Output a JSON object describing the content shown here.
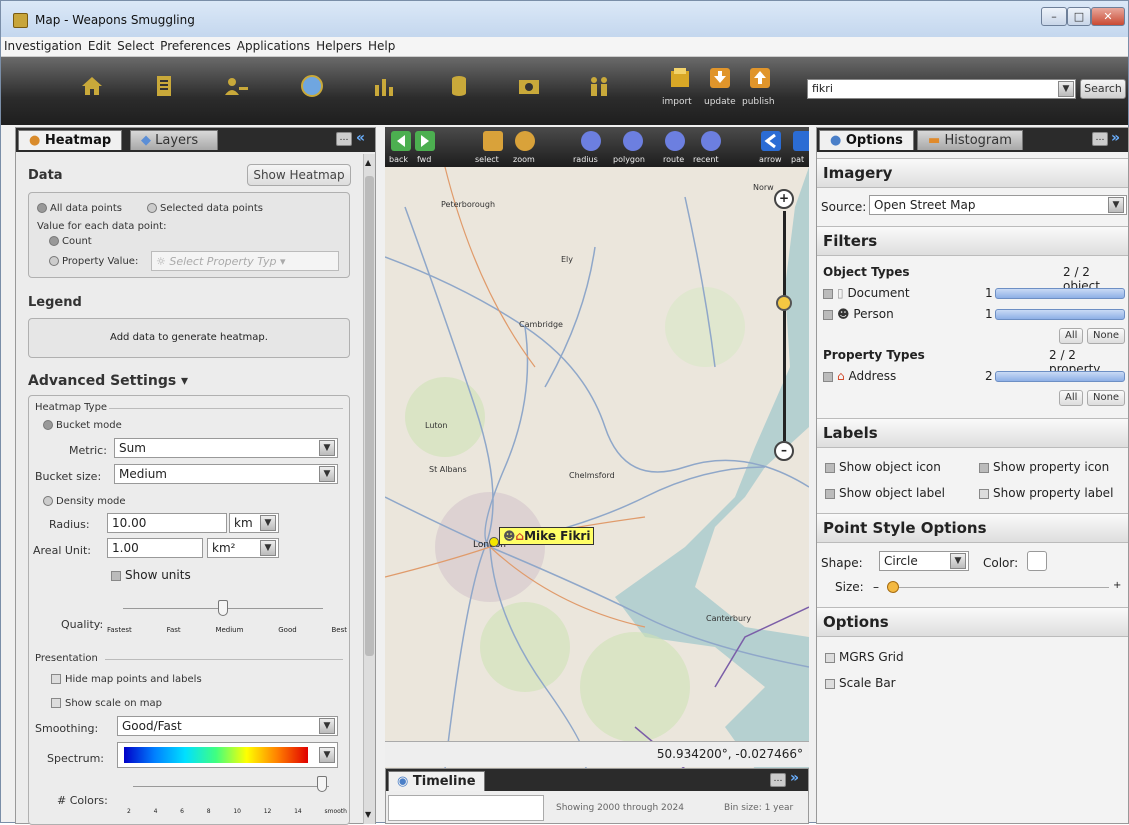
{
  "window": {
    "title": "Map - Weapons Smuggling"
  },
  "menu": [
    "Investigation",
    "Edit",
    "Select",
    "Preferences",
    "Applications",
    "Helpers",
    "Help"
  ],
  "toolbar": {
    "import": "import",
    "update": "update",
    "publish": "publish",
    "search_value": "fikri",
    "search_button": "Search",
    "accent": "#c9a93a"
  },
  "left": {
    "tabs": [
      "Heatmap",
      "Layers"
    ],
    "data_title": "Data",
    "show_heatmap": "Show Heatmap",
    "all_points": "All data points",
    "selected_points": "Selected data points",
    "value_for": "Value for each data point:",
    "count": "Count",
    "property_value": "Property Value:",
    "property_placeholder": "Select Property Typ",
    "legend_title": "Legend",
    "legend_text": "Add data to generate heatmap.",
    "advanced": "Advanced Settings ▾",
    "heatmap_type": "Heatmap Type",
    "bucket_mode": "Bucket mode",
    "metric_label": "Metric:",
    "metric_value": "Sum",
    "bucket_size_label": "Bucket size:",
    "bucket_size_value": "Medium",
    "density_mode": "Density mode",
    "radius_label": "Radius:",
    "radius_value": "10.00",
    "radius_unit": "km",
    "areal_label": "Areal Unit:",
    "areal_value": "1.00",
    "areal_unit": "km²",
    "show_units": "Show units",
    "quality_label": "Quality:",
    "quality_ticks": [
      "Fastest",
      "Fast",
      "Medium",
      "Good",
      "Best"
    ],
    "quality_level": 0.5,
    "presentation": "Presentation",
    "hide_points": "Hide map points and labels",
    "show_scale": "Show scale on map",
    "smoothing_label": "Smoothing:",
    "smoothing_value": "Good/Fast",
    "spectrum_label": "Spectrum:",
    "colors_label": "# Colors:",
    "colors_ticks": [
      "2",
      "4",
      "6",
      "8",
      "10",
      "12",
      "14",
      "smooth"
    ]
  },
  "map": {
    "tools": [
      "back",
      "fwd",
      "select",
      "zoom",
      "radius",
      "polygon",
      "route",
      "recent",
      "arrow",
      "pat"
    ],
    "places": [
      "Peterborough",
      "Ely",
      "Cambridge",
      "Luton",
      "St Albans",
      "Chelmsford",
      "London",
      "Canterbury",
      "Norw"
    ],
    "marker_label": "Mike Fikri",
    "coordinates": "50.934200°, -0.027466°",
    "zoom_level": 0.4
  },
  "timeline": {
    "title": "Timeline",
    "showing": "Showing 2000 through 2024",
    "bin": "Bin size: 1 year"
  },
  "right": {
    "tabs": [
      "Options",
      "Histogram"
    ],
    "imagery_title": "Imagery",
    "source_label": "Source:",
    "source_value": "Open Street Map",
    "filters_title": "Filters",
    "object_types": "Object Types",
    "object_count": "2 / 2 object",
    "document": "Document",
    "document_n": "1",
    "person": "Person",
    "person_n": "1",
    "all": "All",
    "none": "None",
    "property_types": "Property Types",
    "property_count": "2 / 2 property",
    "address": "Address",
    "address_n": "2",
    "labels_title": "Labels",
    "show_object_icon": "Show object icon",
    "show_property_icon": "Show property icon",
    "show_object_label": "Show object label",
    "show_property_label": "Show property label",
    "point_style_title": "Point Style Options",
    "shape_label": "Shape:",
    "shape_value": "Circle",
    "color_label": "Color:",
    "size_label": "Size:",
    "options_title": "Options",
    "mgrs": "MGRS Grid",
    "scale_bar": "Scale Bar"
  }
}
